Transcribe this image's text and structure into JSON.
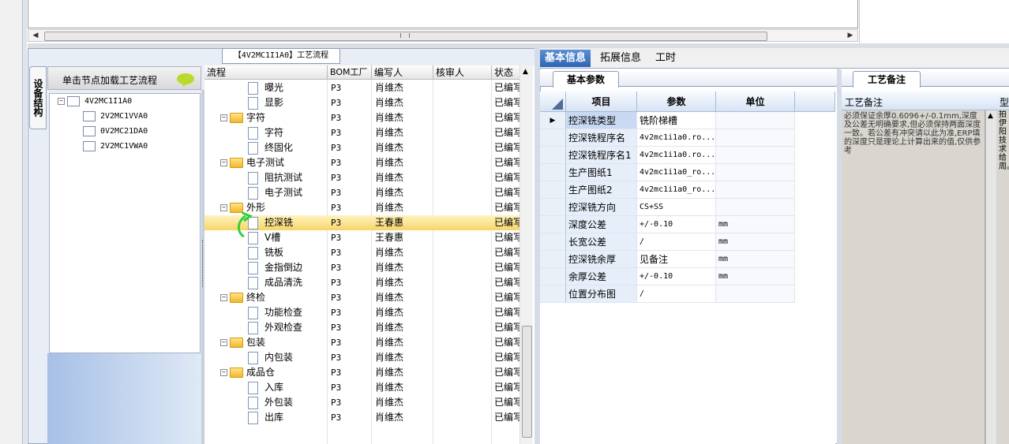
{
  "tree_window_title": "【4V2MC1I1A0】工艺流程",
  "bom_panel": {
    "vertical_tab": "设备结构",
    "header": "单击节点加载工艺流程",
    "nodes": [
      {
        "label": "4V2MC1I1A0",
        "expander": "−"
      },
      {
        "label": "2V2MC1VVA0"
      },
      {
        "label": "0V2MC21DA0"
      },
      {
        "label": "2V2MC1VWA0"
      }
    ]
  },
  "process_grid": {
    "columns": [
      "流程",
      "BOM工厂",
      "编写人",
      "核审人",
      "状态"
    ],
    "rows": [
      {
        "name": "曝光",
        "kind": "doc",
        "factory": "P3",
        "author": "肖维杰",
        "reviewer": "",
        "status": "已编写"
      },
      {
        "name": "显影",
        "kind": "doc",
        "factory": "P3",
        "author": "肖维杰",
        "reviewer": "",
        "status": "已编写"
      },
      {
        "name": "字符",
        "kind": "folder",
        "factory": "P3",
        "author": "肖维杰",
        "reviewer": "",
        "status": "已编写"
      },
      {
        "name": "字符",
        "kind": "doc",
        "factory": "P3",
        "author": "肖维杰",
        "reviewer": "",
        "status": "已编写"
      },
      {
        "name": "终固化",
        "kind": "doc",
        "factory": "P3",
        "author": "肖维杰",
        "reviewer": "",
        "status": "已编写"
      },
      {
        "name": "电子测试",
        "kind": "folder",
        "factory": "P3",
        "author": "肖维杰",
        "reviewer": "",
        "status": "已编写"
      },
      {
        "name": "阻抗测试",
        "kind": "doc",
        "factory": "P3",
        "author": "肖维杰",
        "reviewer": "",
        "status": "已编写"
      },
      {
        "name": "电子测试",
        "kind": "doc",
        "factory": "P3",
        "author": "肖维杰",
        "reviewer": "",
        "status": "已编写"
      },
      {
        "name": "外形",
        "kind": "folder",
        "factory": "P3",
        "author": "肖维杰",
        "reviewer": "",
        "status": "已编写"
      },
      {
        "name": "控深铣",
        "kind": "doc",
        "factory": "P3",
        "author": "王春惠",
        "reviewer": "",
        "status": "已编写",
        "selected": true
      },
      {
        "name": "V槽",
        "kind": "doc",
        "factory": "P3",
        "author": "王春惠",
        "reviewer": "",
        "status": "已编写"
      },
      {
        "name": "铣板",
        "kind": "doc",
        "factory": "P3",
        "author": "肖维杰",
        "reviewer": "",
        "status": "已编写"
      },
      {
        "name": "金指倒边",
        "kind": "doc",
        "factory": "P3",
        "author": "肖维杰",
        "reviewer": "",
        "status": "已编写"
      },
      {
        "name": "成品清洗",
        "kind": "doc",
        "factory": "P3",
        "author": "肖维杰",
        "reviewer": "",
        "status": "已编写"
      },
      {
        "name": "终检",
        "kind": "folder",
        "factory": "P3",
        "author": "肖维杰",
        "reviewer": "",
        "status": "已编写"
      },
      {
        "name": "功能检查",
        "kind": "doc",
        "factory": "P3",
        "author": "肖维杰",
        "reviewer": "",
        "status": "已编写"
      },
      {
        "name": "外观检查",
        "kind": "doc",
        "factory": "P3",
        "author": "肖维杰",
        "reviewer": "",
        "status": "已编写"
      },
      {
        "name": "包装",
        "kind": "folder",
        "factory": "P3",
        "author": "肖维杰",
        "reviewer": "",
        "status": "已编写"
      },
      {
        "name": "内包装",
        "kind": "doc",
        "factory": "P3",
        "author": "肖维杰",
        "reviewer": "",
        "status": "已编写"
      },
      {
        "name": "成品仓",
        "kind": "folder",
        "factory": "P3",
        "author": "肖维杰",
        "reviewer": "",
        "status": "已编写"
      },
      {
        "name": "入库",
        "kind": "doc",
        "factory": "P3",
        "author": "肖维杰",
        "reviewer": "",
        "status": "已编写"
      },
      {
        "name": "外包装",
        "kind": "doc",
        "factory": "P3",
        "author": "肖维杰",
        "reviewer": "",
        "status": "已编写"
      },
      {
        "name": "出库",
        "kind": "doc",
        "factory": "P3",
        "author": "肖维杰",
        "reviewer": "",
        "status": "已编写"
      }
    ]
  },
  "main_tabs": [
    "基本信息",
    "拓展信息",
    "工时"
  ],
  "basic_params": {
    "tab_label": "基本参数",
    "columns": [
      "项目",
      "参数",
      "单位"
    ],
    "rows": [
      {
        "item": "控深铣类型",
        "value": "铣阶梯槽",
        "unit": "",
        "current": true
      },
      {
        "item": "控深铣程序名",
        "value": "4v2mc1i1a0.ro...",
        "unit": ""
      },
      {
        "item": "控深铣程序名1",
        "value": "4v2mc1i1a0.ro...",
        "unit": ""
      },
      {
        "item": "生产图纸1",
        "value": "4v2mc1i1a0_ro...",
        "unit": ""
      },
      {
        "item": "生产图纸2",
        "value": "4v2mc1i1a0_ro...",
        "unit": ""
      },
      {
        "item": "控深铣方向",
        "value": "CS+SS",
        "unit": ""
      },
      {
        "item": "深度公差",
        "value": "+/-0.10",
        "unit": "mm"
      },
      {
        "item": "长宽公差",
        "value": "/",
        "unit": "mm"
      },
      {
        "item": "控深铣余厚",
        "value": "见备注",
        "unit": "mm"
      },
      {
        "item": "余厚公差",
        "value": "+/-0.10",
        "unit": "mm"
      },
      {
        "item": "位置分布图",
        "value": "/",
        "unit": ""
      }
    ]
  },
  "remark_panel": {
    "tab_label": "工艺备注",
    "column_header": "工艺备注",
    "column_header2": "型",
    "text": "必须保证余厚0.6096+/-0.1mm,深度及公差无明确要求,但必须保持两面深度一致。若公差有冲突请以此为准,ERP填的深度只是理论上计算出来的值,仅供参考",
    "col2_text": "拍伊阳技求给周。"
  }
}
